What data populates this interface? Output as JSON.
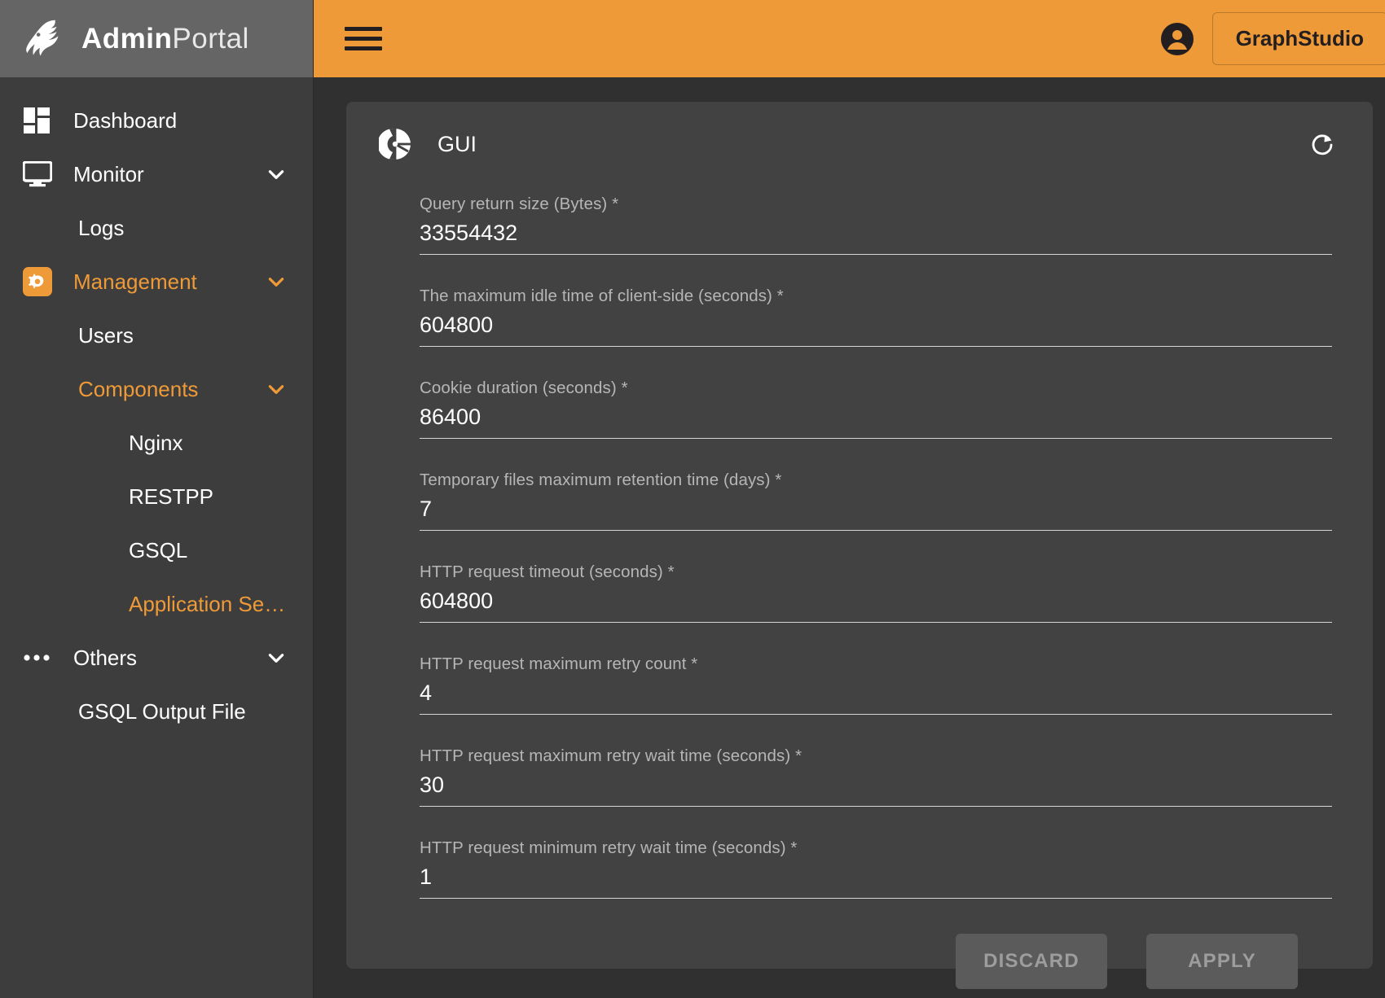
{
  "brand": {
    "name_bold": "Admin",
    "name_light": "Portal",
    "logo_icon": "dragon-head-icon"
  },
  "topbar": {
    "menu_icon": "hamburger-menu-icon",
    "account_icon": "account-circle-icon",
    "studio_button": "GraphStudio",
    "accent_color": "#ef9a38"
  },
  "sidebar": {
    "items": [
      {
        "label": "Dashboard",
        "icon": "dashboard-grid-icon",
        "level": 0,
        "accent": false,
        "chevron": false
      },
      {
        "label": "Monitor",
        "icon": "monitor-display-icon",
        "level": 0,
        "accent": false,
        "chevron": true
      },
      {
        "label": "Logs",
        "icon": "",
        "level": 1,
        "accent": false,
        "chevron": false
      },
      {
        "label": "Management",
        "icon": "gear-settings-icon",
        "level": 0,
        "accent": true,
        "chevron": true
      },
      {
        "label": "Users",
        "icon": "",
        "level": 1,
        "accent": false,
        "chevron": false
      },
      {
        "label": "Components",
        "icon": "",
        "level": 1,
        "accent": true,
        "chevron": true
      },
      {
        "label": "Nginx",
        "icon": "",
        "level": 2,
        "accent": false,
        "chevron": false
      },
      {
        "label": "RESTPP",
        "icon": "",
        "level": 2,
        "accent": false,
        "chevron": false
      },
      {
        "label": "GSQL",
        "icon": "",
        "level": 2,
        "accent": false,
        "chevron": false
      },
      {
        "label": "Application Serv…",
        "icon": "",
        "level": 2,
        "accent": true,
        "chevron": false
      },
      {
        "label": "Others",
        "icon": "ellipsis-icon",
        "level": 0,
        "accent": false,
        "chevron": true
      },
      {
        "label": "GSQL Output File",
        "icon": "",
        "level": 1,
        "accent": false,
        "chevron": false
      }
    ]
  },
  "card": {
    "title": "GUI",
    "title_icon": "pie-chart-icon",
    "refresh_icon": "refresh-icon",
    "fields": [
      {
        "label": "Query return size (Bytes) *",
        "value": "33554432"
      },
      {
        "label": "The maximum idle time of client-side (seconds) *",
        "value": "604800"
      },
      {
        "label": "Cookie duration (seconds) *",
        "value": "86400"
      },
      {
        "label": "Temporary files maximum retention time (days) *",
        "value": "7"
      },
      {
        "label": "HTTP request timeout (seconds) *",
        "value": "604800"
      },
      {
        "label": "HTTP request maximum retry count *",
        "value": "4"
      },
      {
        "label": "HTTP request maximum retry wait time (seconds) *",
        "value": "30"
      },
      {
        "label": "HTTP request minimum retry wait time (seconds) *",
        "value": "1"
      }
    ],
    "discard_button": "DISCARD",
    "apply_button": "APPLY"
  }
}
